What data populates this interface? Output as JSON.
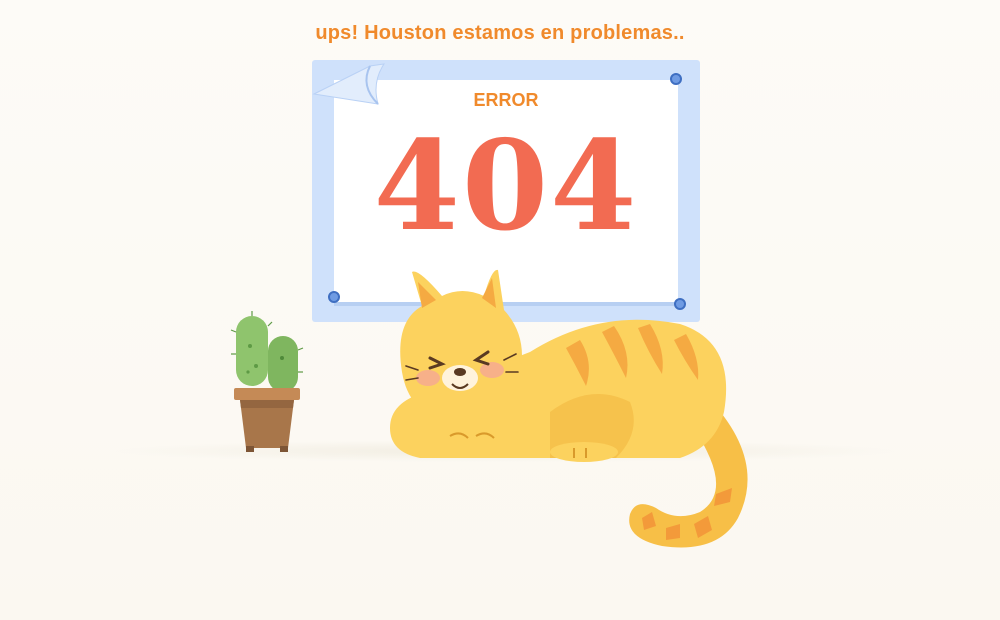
{
  "page": {
    "headline": "ups! Houston estamos en problemas..",
    "poster": {
      "label": "ERROR",
      "code": "404"
    }
  },
  "colors": {
    "background": "#fcfaf5",
    "headline": "#f08a2c",
    "code": "#f26b52",
    "poster_frame": "#cfe1fb",
    "pin": "#6f9be3",
    "cat_body": "#fbd35c",
    "cat_stripes": "#f5a940",
    "cactus": "#8cc36b",
    "pot": "#b07a4e"
  },
  "icons": {
    "cat": "sleeping-cat-illustration",
    "cactus": "potted-cactus-illustration"
  }
}
